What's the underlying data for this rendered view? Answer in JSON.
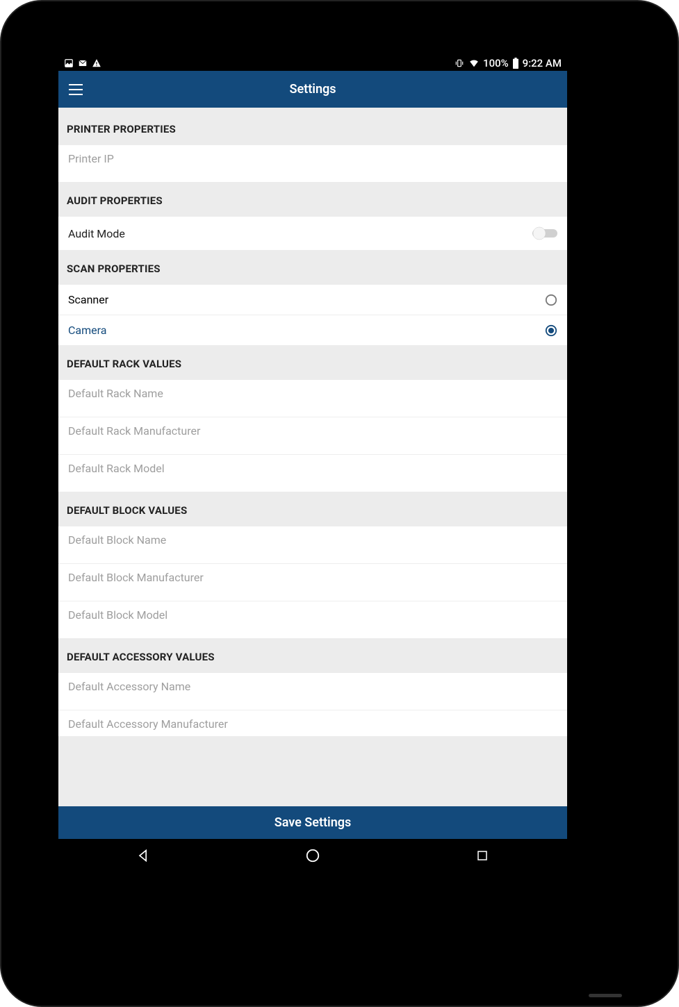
{
  "status": {
    "battery_pct": "100%",
    "time": "9:22 AM"
  },
  "appbar": {
    "title": "Settings"
  },
  "sections": {
    "printer": {
      "header": "PRINTER PROPERTIES",
      "printer_ip_placeholder": "Printer IP",
      "printer_ip_value": ""
    },
    "audit": {
      "header": "AUDIT PROPERTIES",
      "audit_mode_label": "Audit Mode",
      "audit_mode_on": false
    },
    "scan": {
      "header": "SCAN PROPERTIES",
      "options": [
        {
          "label": "Scanner",
          "selected": false
        },
        {
          "label": "Camera",
          "selected": true
        }
      ]
    },
    "rack": {
      "header": "DEFAULT RACK VALUES",
      "name_placeholder": "Default Rack Name",
      "manufacturer_placeholder": "Default Rack Manufacturer",
      "model_placeholder": "Default Rack Model"
    },
    "block": {
      "header": "DEFAULT BLOCK VALUES",
      "name_placeholder": "Default Block Name",
      "manufacturer_placeholder": "Default Block Manufacturer",
      "model_placeholder": "Default Block Model"
    },
    "accessory": {
      "header": "DEFAULT ACCESSORY VALUES",
      "name_placeholder": "Default Accessory Name",
      "manufacturer_placeholder": "Default Accessory Manufacturer"
    }
  },
  "save_button_label": "Save Settings"
}
